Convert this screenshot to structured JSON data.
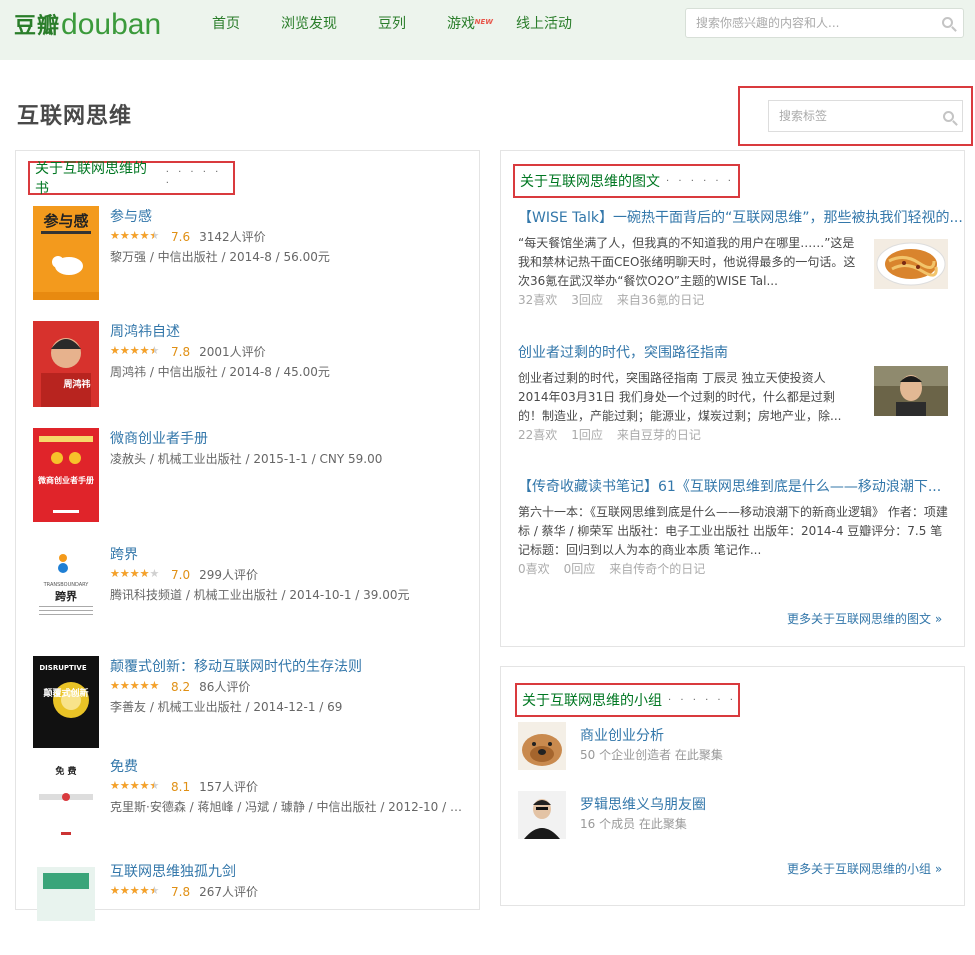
{
  "nav": {
    "logo_cn": "豆瓣",
    "logo_en": "douban",
    "items": [
      {
        "label": "首页"
      },
      {
        "label": "浏览发现"
      },
      {
        "label": "豆列"
      },
      {
        "label": "游戏",
        "badge": "NEW"
      },
      {
        "label": "线上活动"
      }
    ],
    "search_placeholder": "搜索你感兴趣的内容和人..."
  },
  "page": {
    "title": "互联网思维",
    "tag_search_placeholder": "搜索标签"
  },
  "books": {
    "header": "关于互联网思维的书",
    "header_dots": "· · · · · ·",
    "items": [
      {
        "title": "参与感",
        "stars": 4,
        "score": "7.6",
        "votes": "3142人评价",
        "pub": "黎万强 / 中信出版社 / 2014-8 / 56.00元"
      },
      {
        "title": "周鸿祎自述",
        "stars": 4,
        "score": "7.8",
        "votes": "2001人评价",
        "pub": "周鸿祎 / 中信出版社 / 2014-8 / 45.00元"
      },
      {
        "title": "微商创业者手册",
        "pub": "凌赦头 / 机械工业出版社 / 2015-1-1 / CNY 59.00"
      },
      {
        "title": "跨界",
        "stars": 3.5,
        "score": "7.0",
        "votes": "299人评价",
        "pub": "腾讯科技频道 / 机械工业出版社 / 2014-10-1 / 39.00元"
      },
      {
        "title": "颠覆式创新：移动互联网时代的生存法则",
        "stars": 4.5,
        "score": "8.2",
        "votes": "86人评价",
        "pub": "李善友 / 机械工业出版社 / 2014-12-1 / 69"
      },
      {
        "title": "免费",
        "stars": 4,
        "score": "8.1",
        "votes": "157人评价",
        "pub": "克里斯·安德森 / 蒋旭峰 / 冯斌 / 璩静 / 中信出版社 / 2012-10 / 68...."
      },
      {
        "title": "互联网思维独孤九剑",
        "stars": 4,
        "score": "7.8",
        "votes": "267人评价",
        "pub": ""
      }
    ]
  },
  "notes": {
    "header": "关于互联网思维的图文",
    "header_dots": "· · · · · ·",
    "items": [
      {
        "title": "【WISE Talk】一碗热干面背后的“互联网思维”，那些被执我们轻视的...",
        "body": "“每天餐馆坐满了人，但我真的不知道我的用户在哪里……”这是我和禁林记热干面CEO张绪明聊天时，他说得最多的一句话。这次36氪在武汉举办“餐饮O2O”主题的WISE Tal...",
        "likes": "32喜欢",
        "replies": "3回应",
        "source": "来自36氪的日记"
      },
      {
        "title": "创业者过剩的时代，突围路径指南",
        "body": "创业者过剩的时代，突围路径指南 丁辰灵 独立天使投资人 2014年03月31日 我们身处一个过剩的时代，什么都是过剩的！制造业，产能过剩；能源业，煤炭过剩；房地产业，除...",
        "likes": "22喜欢",
        "replies": "1回应",
        "source": "来自豆芽的日记"
      },
      {
        "title": "【传奇收藏读书笔记】61《互联网思维到底是什么——移动浪潮下...",
        "body": "第六十一本：《互联网思维到底是什么——移动浪潮下的新商业逻辑》 作者：项建标 / 蔡华 / 柳荣军 出版社：电子工业出版社 出版年：2014-4 豆瓣评分：7.5 笔记标题：回归到以人为本的商业本质 笔记作...",
        "likes": "0喜欢",
        "replies": "0回应",
        "source": "来自传奇个的日记"
      }
    ],
    "more": "更多关于互联网思维的图文 »"
  },
  "groups": {
    "header": "关于互联网思维的小组",
    "header_dots": "· · · · · ·",
    "items": [
      {
        "name": "商业创业分析",
        "meta": "50 个企业创造者 在此聚集"
      },
      {
        "name": "罗辑思维义乌朋友圈",
        "meta": "16 个成员 在此聚集"
      }
    ],
    "more": "更多关于互联网思维的小组 »"
  },
  "colors": {
    "nav_bg": "#edf4ed",
    "link": "#3377aa",
    "green": "#007722",
    "highlight_border": "#d93a3e",
    "star": "#f6a128"
  }
}
